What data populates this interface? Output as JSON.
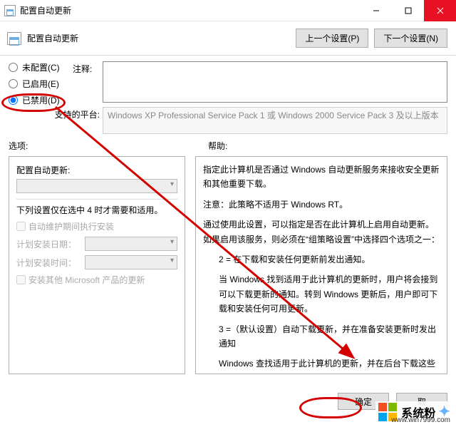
{
  "titlebar": {
    "title": "配置自动更新"
  },
  "header": {
    "heading": "配置自动更新",
    "prev": "上一个设置(P)",
    "next": "下一个设置(N)"
  },
  "radios": {
    "not_configured": "未配置(C)",
    "enabled": "已启用(E)",
    "disabled": "已禁用(D)"
  },
  "comment": {
    "label": "注释:"
  },
  "platform": {
    "label": "支持的平台:",
    "text": "Windows XP Professional Service Pack 1 或 Windows 2000 Service Pack 3 及以上版本"
  },
  "labels": {
    "options": "选项:",
    "help": "帮助:"
  },
  "left": {
    "heading": "配置自动更新:",
    "note": "下列设置仅在选中 4 时才需要和适用。",
    "cb_maint": "自动维护期间执行安装",
    "plan_date": "计划安装日期：",
    "plan_time": "计划安装时间：",
    "cb_other": "安装其他 Microsoft 产品的更新"
  },
  "help": {
    "p1": "指定此计算机是否通过 Windows 自动更新服务来接收安全更新和其他重要下载。",
    "p2": "注意：此策略不适用于 Windows RT。",
    "p3": "通过使用此设置，可以指定是否在此计算机上启用自动更新。如果启用该服务，则必须在“组策略设置”中选择四个选项之一：",
    "p4": "2 = 在下载和安装任何更新前发出通知。",
    "p5": "当 Windows 找到适用于此计算机的更新时，用户将会接到可以下载更新的通知。转到 Windows 更新后，用户即可下载和安装任何可用更新。",
    "p6": "3 =（默认设置）自动下载更新，并在准备安装更新时发出通知",
    "p7": "Windows 查找适用于此计算机的更新，并在后台下载这些更新（在此过程中，用户不会收到通知或被打断工作）。完成下载后，用户即可以安装更新的通知。转到 Windows 更新后，用户即可安装"
  },
  "footer": {
    "ok": "确定",
    "cancel": "取"
  },
  "watermark": {
    "brand": "系统粉",
    "url": "www.win7999.com"
  }
}
